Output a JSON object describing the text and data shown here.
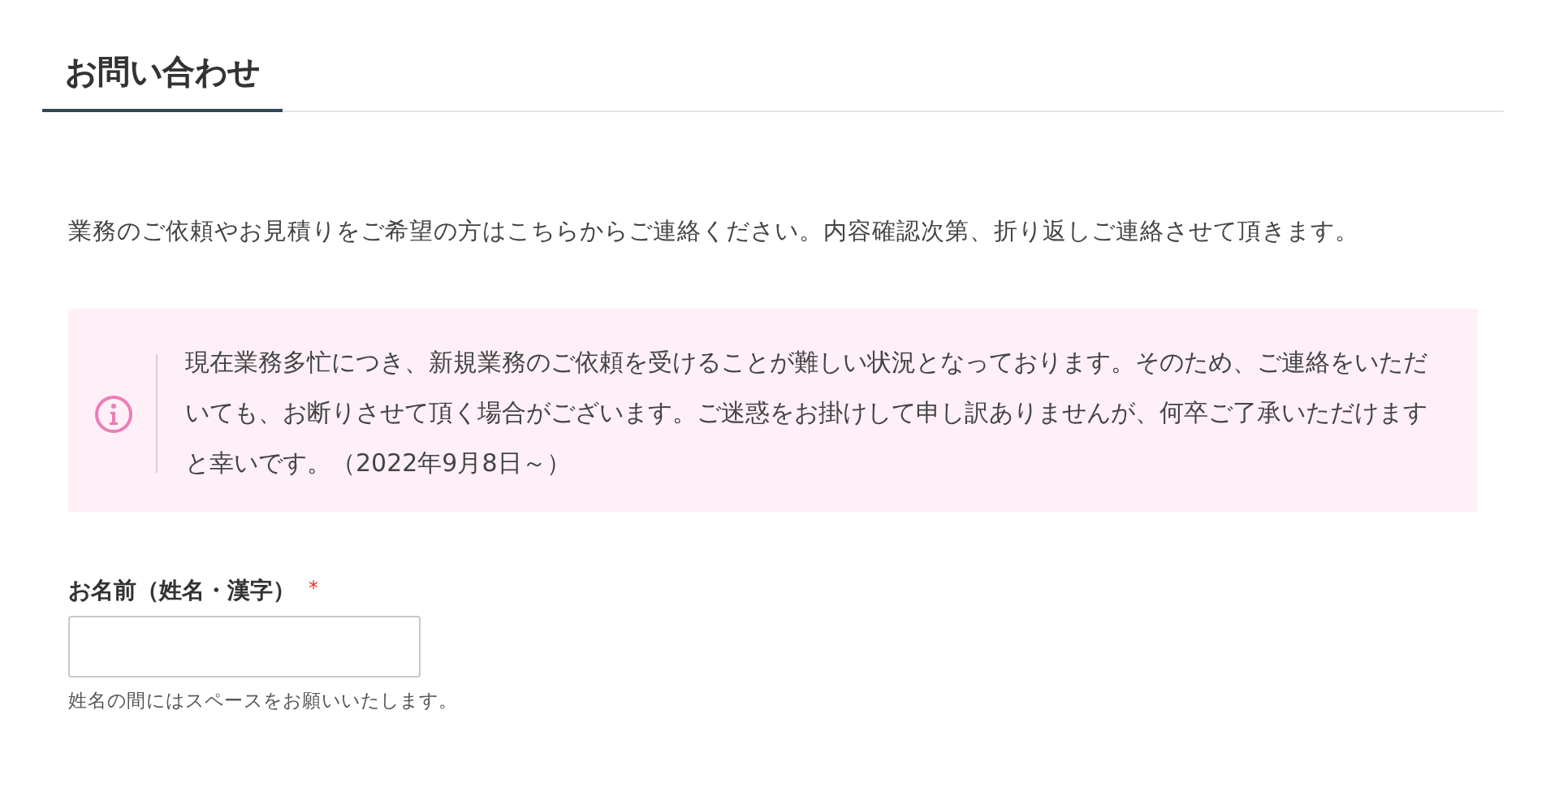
{
  "page_title": "お問い合わせ",
  "intro": "業務のご依頼やお見積りをご希望の方はこちらからご連絡ください。内容確認次第、折り返しご連絡させて頂きます。",
  "notice": {
    "kind": "info",
    "text": "現在業務多忙につき、新規業務のご依頼を受けることが難しい状況となっております。そのため、ご連絡をいただいても、お断りさせて頂く場合がございます。ご迷惑をお掛けして申し訳ありませんが、何卒ご了承いただけますと幸いです。（2022年9月8日～）"
  },
  "fields": [
    {
      "label": "お名前（姓名・漢字）",
      "required_mark": "*",
      "hint": "姓名の間にはスペースをお願いいたします。"
    }
  ]
}
